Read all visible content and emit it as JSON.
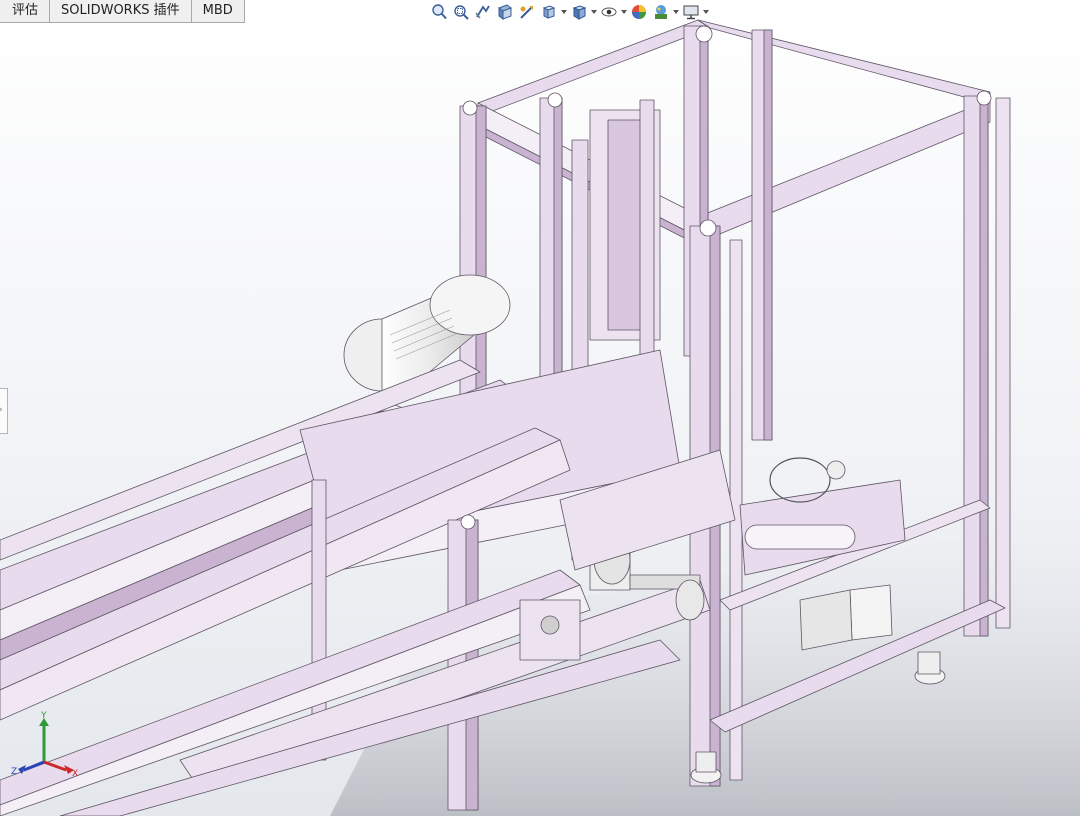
{
  "tabs": [
    {
      "label": "评估"
    },
    {
      "label": "SOLIDWORKS 插件"
    },
    {
      "label": "MBD"
    }
  ],
  "hud": {
    "tools": [
      {
        "icon": "zoom-to-fit-icon"
      },
      {
        "icon": "zoom-to-area-icon"
      },
      {
        "icon": "previous-view-icon"
      },
      {
        "icon": "section-view-icon"
      },
      {
        "icon": "dynamic-annotation-icon"
      },
      {
        "icon": "view-orientation-icon",
        "dropdown": true
      },
      {
        "icon": "display-style-icon",
        "dropdown": true
      },
      {
        "icon": "hide-show-items-icon",
        "dropdown": true
      },
      {
        "icon": "edit-appearance-icon"
      },
      {
        "icon": "apply-scene-icon",
        "dropdown": true
      },
      {
        "icon": "view-settings-icon",
        "dropdown": true
      }
    ]
  },
  "triad": {
    "x_label": "X",
    "y_label": "Y",
    "z_label": "Z"
  },
  "colors": {
    "profile": "#e9dbee",
    "profile_dark": "#c9b3d1",
    "profile_edge": "#5d5563",
    "metal": "#f4f4f4",
    "tab_bg": "#f0f0f0"
  }
}
